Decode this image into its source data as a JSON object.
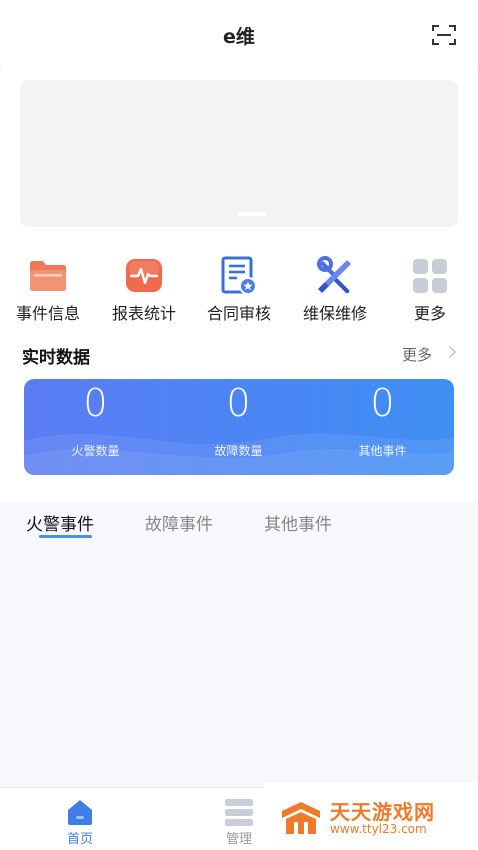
{
  "header": {
    "title": "e维",
    "scan_icon": "scan-icon"
  },
  "quick_actions": [
    {
      "label": "事件信息",
      "icon": "folder-icon",
      "color": "#f0785a"
    },
    {
      "label": "报表统计",
      "icon": "pulse-chart-icon",
      "color": "#ef6a4f"
    },
    {
      "label": "合同审核",
      "icon": "contract-review-icon",
      "color": "#3c6fd8"
    },
    {
      "label": "维保维修",
      "icon": "wrench-screwdriver-icon",
      "color": "#4f6ee6"
    },
    {
      "label": "更多",
      "icon": "grid-more-icon",
      "color": "#c7ccd6"
    }
  ],
  "realtime": {
    "title": "实时数据",
    "more_label": "更多",
    "stats": [
      {
        "value": "0",
        "label": "火警数量"
      },
      {
        "value": "0",
        "label": "故障数量"
      },
      {
        "value": "0",
        "label": "其他事件"
      }
    ]
  },
  "tabs": [
    {
      "label": "火警事件",
      "active": true
    },
    {
      "label": "故障事件",
      "active": false
    },
    {
      "label": "其他事件",
      "active": false
    }
  ],
  "bottom_nav": [
    {
      "label": "首页",
      "icon": "home-icon",
      "active": true
    },
    {
      "label": "管理",
      "icon": "list-icon",
      "active": false
    }
  ],
  "watermark": {
    "name": "天天游戏网",
    "url": "www.ttyl23.com"
  },
  "colors": {
    "accent": "#4a8fe8",
    "stats_gradient_start": "#5b7cf2",
    "stats_gradient_end": "#3f8ff3",
    "watermark": "#ef7a2a"
  }
}
